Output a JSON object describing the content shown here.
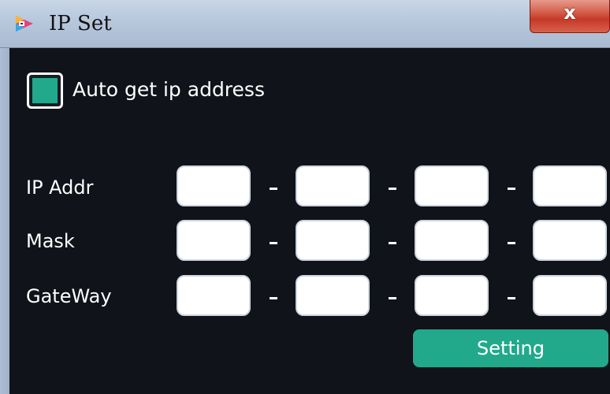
{
  "window": {
    "title": "IP Set",
    "close_glyph": "x"
  },
  "auto_ip": {
    "label": "Auto get ip address",
    "checked": true
  },
  "rows": [
    {
      "label": "IP Addr",
      "octets": [
        "",
        "",
        "",
        ""
      ]
    },
    {
      "label": "Mask",
      "octets": [
        "",
        "",
        "",
        ""
      ]
    },
    {
      "label": "GateWay",
      "octets": [
        "",
        "",
        "",
        ""
      ]
    }
  ],
  "separator": "-",
  "buttons": {
    "setting_label": "Setting"
  },
  "icons": {
    "app": "app-play-icon",
    "close": "close-icon"
  },
  "colors": {
    "accent": "#22a98b",
    "background": "#10131a",
    "close": "#c43a27"
  }
}
